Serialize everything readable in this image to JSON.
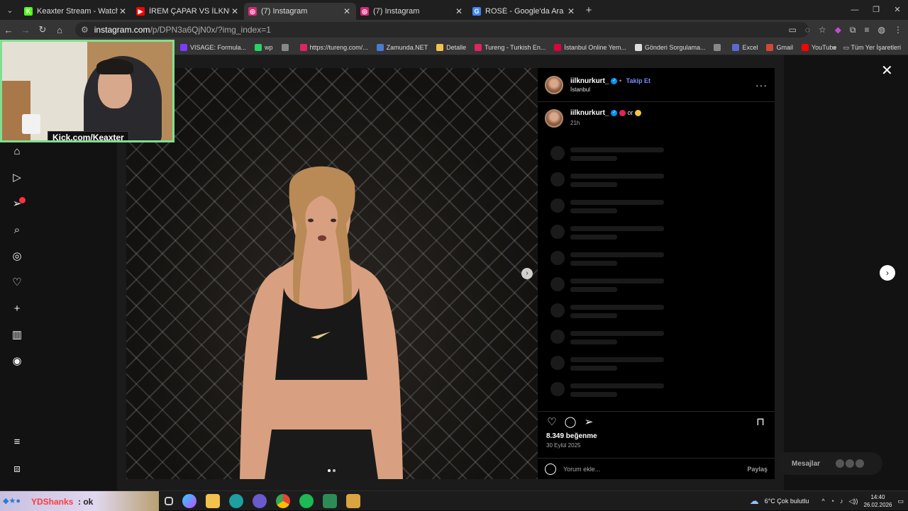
{
  "browser": {
    "tabs": [
      {
        "title": "Keaxter Stream - Watch Live on",
        "favicon_color": "#53fc18",
        "glyph": "K",
        "active": false
      },
      {
        "title": "İREM ÇAPAR VS İLKNUR KURT",
        "favicon_color": "#ff0000",
        "glyph": "▶",
        "active": false
      },
      {
        "title": "(7) Instagram",
        "favicon_color": "#d62976",
        "glyph": "◎",
        "active": true
      },
      {
        "title": "(7) Instagram",
        "favicon_color": "#d62976",
        "glyph": "◎",
        "active": false
      },
      {
        "title": "ROSÉ - Google'da Ara",
        "favicon_color": "#4285f4",
        "glyph": "G",
        "active": false
      }
    ],
    "url_host": "instagram.com",
    "url_path": "/p/DPN3a6QjN0x/?img_index=1",
    "bookmarks": [
      "VISAGE: Formula...",
      "wp",
      "",
      "https://tureng.com/...",
      "Zamunda.NET",
      "Detalle",
      "Tureng - Turkish En...",
      "İstanbul Online Yem...",
      "Gönderi Sorgulama...",
      "",
      "Excel",
      "Gmail",
      "YouTube"
    ],
    "bookmarks_all": "Tüm Yer İşaretleri"
  },
  "post": {
    "username": "iilknurkurt_",
    "follow_label": "Takip Et",
    "location": "İstanbul",
    "caption_username": "iilknurkurt_",
    "caption_text": "or",
    "caption_age": "21h",
    "likes": "8.349 beğenme",
    "date": "30 Eylül 2025",
    "comment_placeholder": "Yorum ekle...",
    "post_label": "Paylaş"
  },
  "messages_label": "Mesajlar",
  "overlay": {
    "kick_label": "Kick.com/Keaxter"
  },
  "chat": {
    "name": "YDShanks",
    "text": ": ok"
  },
  "taskbar": {
    "weather": "6°C  Çok bulutlu",
    "time": "14:40",
    "date": "26.02.2026"
  },
  "colors": {
    "accent_blue": "#0095f6",
    "follow_blue": "#7a8cff",
    "webcam_border": "#7fe08f"
  }
}
